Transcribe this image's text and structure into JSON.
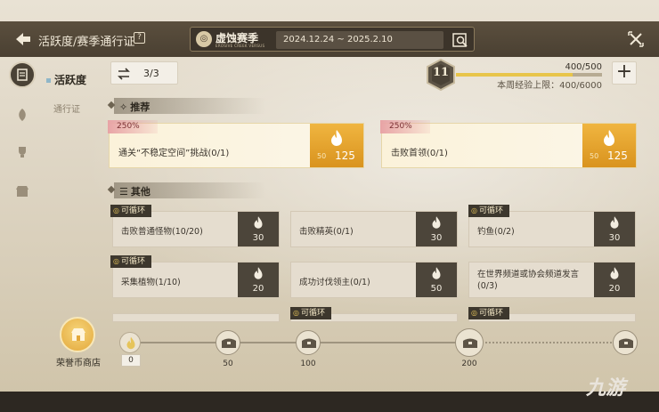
{
  "header": {
    "title": "活跃度/赛季通行证",
    "season_name": "虚蚀赛季",
    "season_sub": "EROSIVE CREEK VERSUS",
    "season_dates": "2024.12.24 ~ 2025.2.10"
  },
  "subnav": {
    "active_label": "活跃度",
    "inactive_label": "通行证"
  },
  "counter": {
    "value": "3/3"
  },
  "level": {
    "value": "11",
    "xp_text": "400/500",
    "xp_progress": 0.8,
    "weekly_cap": "本周经验上限：400/6000"
  },
  "sections": {
    "recommended": "推荐",
    "other": "其他"
  },
  "recommended_tasks": [
    {
      "tag": "250%",
      "title": "通关“不稳定空间”挑战(0/1)",
      "old_reward": "50",
      "reward": "125"
    },
    {
      "tag": "250%",
      "title": "击败首领(0/1)",
      "old_reward": "50",
      "reward": "125"
    }
  ],
  "loop_label": "可循环",
  "tasks": [
    {
      "title": "击败普通怪物(10/20)",
      "reward": "30"
    },
    {
      "title": "击败精英(0/1)",
      "reward": "30"
    },
    {
      "title": "钓鱼(0/2)",
      "reward": "30"
    },
    {
      "title": "采集植物(1/10)",
      "reward": "20"
    },
    {
      "title": "成功讨伐领主(0/1)",
      "reward": "50"
    },
    {
      "title": "在世界频道或协会频道发言(0/3)",
      "reward": "20"
    }
  ],
  "shop": {
    "label": "荣誉币商店"
  },
  "track": {
    "current": "0",
    "milestones": [
      "50",
      "100",
      "200"
    ]
  },
  "watermark": "九游",
  "colors": {
    "accent_gold": "#e8c54a",
    "reward_orange": "#e3a12e",
    "reward_dark": "#4c453a",
    "tag_pink": "#e8a4a6"
  }
}
